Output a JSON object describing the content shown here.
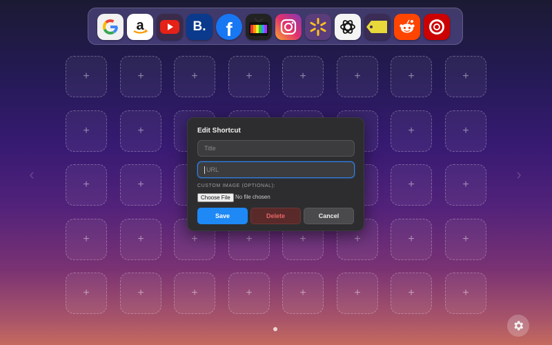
{
  "dock": {
    "shortcuts": [
      {
        "name": "Google",
        "icon": "google-icon"
      },
      {
        "name": "Amazon",
        "icon": "amazon-icon"
      },
      {
        "name": "YouTube",
        "icon": "youtube-icon"
      },
      {
        "name": "Booking",
        "icon": "booking-icon",
        "glyph": "B."
      },
      {
        "name": "Facebook",
        "icon": "facebook-icon",
        "glyph": "f"
      },
      {
        "name": "TV",
        "icon": "tv-icon"
      },
      {
        "name": "Instagram",
        "icon": "instagram-icon"
      },
      {
        "name": "Walmart",
        "icon": "walmart-icon"
      },
      {
        "name": "ChatGPT",
        "icon": "chatgpt-icon"
      },
      {
        "name": "Tag",
        "icon": "price-tag-icon"
      },
      {
        "name": "Reddit",
        "icon": "reddit-icon"
      },
      {
        "name": "Target",
        "icon": "target-icon"
      }
    ]
  },
  "grid": {
    "add_symbol": "+",
    "rows": 5,
    "cols": 8
  },
  "modal": {
    "title": "Edit Shortcut",
    "title_placeholder": "Title",
    "url_placeholder": "URL",
    "image_label": "CUSTOM IMAGE (OPTIONAL):",
    "file_button": "Choose File",
    "file_status": "No file chosen",
    "save_label": "Save",
    "delete_label": "Delete",
    "cancel_label": "Cancel"
  },
  "colors": {
    "accent": "#1e88f5",
    "danger": "#e86565"
  }
}
